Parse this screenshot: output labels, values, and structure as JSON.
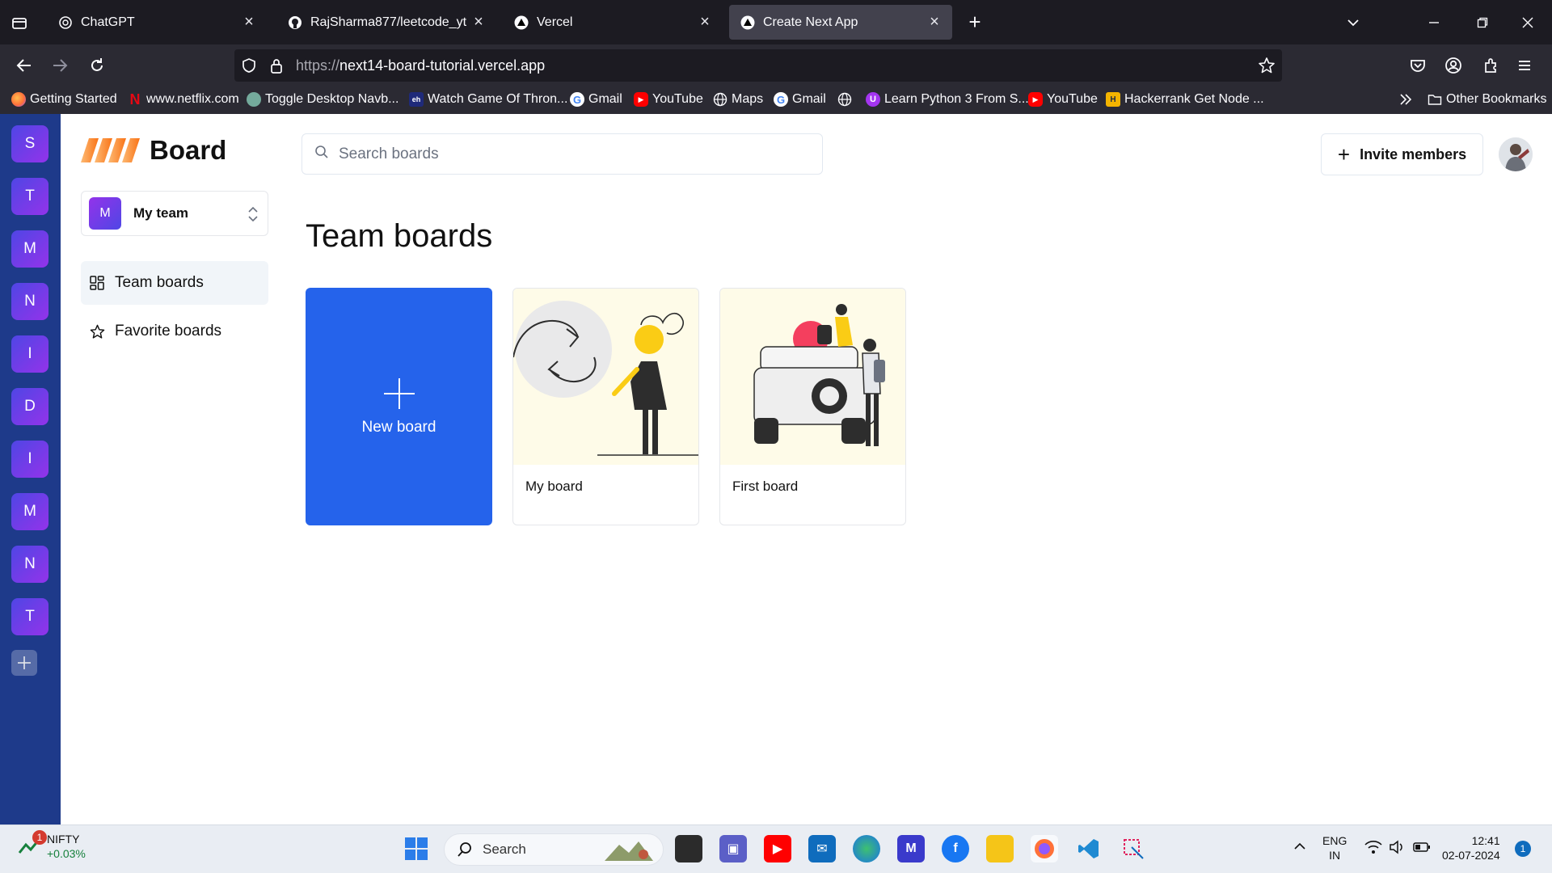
{
  "browser": {
    "tabs": [
      {
        "title": "ChatGPT",
        "icon": "chatgpt-icon",
        "active": false
      },
      {
        "title": "RajSharma877/leetcode_yt",
        "icon": "github-icon",
        "active": false
      },
      {
        "title": "Vercel",
        "icon": "vercel-icon",
        "active": false
      },
      {
        "title": "Create Next App",
        "icon": "vercel-icon",
        "active": true
      }
    ],
    "url_scheme": "https://",
    "url_host": "next14-board-tutorial.vercel.app",
    "bookmarks": [
      {
        "label": "Getting Started",
        "icon": "firefox-icon",
        "color": "#ff7139"
      },
      {
        "label": "www.netflix.com",
        "icon": "netflix-icon",
        "color": "#e50914"
      },
      {
        "label": "Toggle Desktop Navb...",
        "icon": "openai-icon",
        "color": "#74aa9c"
      },
      {
        "label": "Watch Game Of Thron...",
        "icon": "site-icon",
        "color": "#1f2a7a"
      },
      {
        "label": "Gmail",
        "icon": "google-icon",
        "color": "#ffffff"
      },
      {
        "label": "YouTube",
        "icon": "youtube-icon",
        "color": "#ff0000"
      },
      {
        "label": "Maps",
        "icon": "globe-icon",
        "color": "#2b2a33"
      },
      {
        "label": "Gmail",
        "icon": "google-icon",
        "color": "#ffffff"
      },
      {
        "label": "",
        "icon": "globe-icon",
        "color": "#2b2a33"
      },
      {
        "label": "Learn Python 3 From S...",
        "icon": "udemy-icon",
        "color": "#a435f0"
      },
      {
        "label": "YouTube",
        "icon": "youtube-icon",
        "color": "#ff0000"
      },
      {
        "label": "Hackerrank Get Node ...",
        "icon": "hackerrank-icon",
        "color": "#f4b400"
      }
    ],
    "other_bookmarks": "Other Bookmarks"
  },
  "org_sidebar": {
    "orgs": [
      "S",
      "T",
      "M",
      "N",
      "I",
      "D",
      "I",
      "M",
      "N",
      "T"
    ]
  },
  "app": {
    "logo_text": "Board",
    "team": {
      "initial": "M",
      "name": "My team"
    },
    "nav": [
      {
        "label": "Team boards",
        "icon": "dashboard-icon",
        "active": true
      },
      {
        "label": "Favorite boards",
        "icon": "star-icon",
        "active": false
      }
    ],
    "search_placeholder": "Search boards",
    "invite_label": "Invite members",
    "page_title": "Team boards",
    "new_board_label": "New board",
    "boards": [
      {
        "title": "My board",
        "illustration": "person-with-cycle-arrows"
      },
      {
        "title": "First board",
        "illustration": "people-with-jeep"
      }
    ],
    "accent": "#2563eb"
  },
  "taskbar": {
    "widget_name": "NIFTY",
    "widget_value": "+0.03%",
    "widget_badge": "1",
    "search_label": "Search",
    "lang_1": "ENG",
    "lang_2": "IN",
    "time": "12:41",
    "date": "02-07-2024",
    "notif_count": "1"
  }
}
